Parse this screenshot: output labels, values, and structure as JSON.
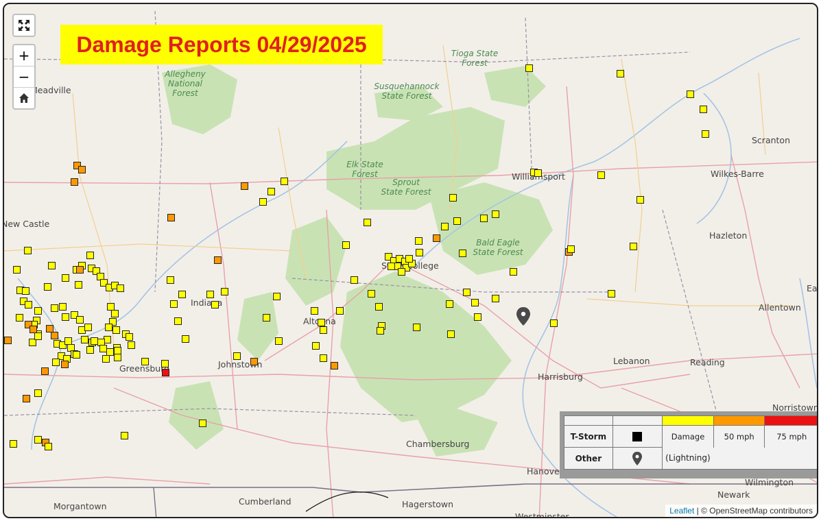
{
  "title": "Damage Reports 04/29/2025",
  "colors": {
    "damage": "#ffff00",
    "mph50": "#ff9900",
    "mph75": "#ee1111"
  },
  "controls": {
    "fullscreen_icon": "fullscreen-icon",
    "zoom_in": "+",
    "zoom_out": "−",
    "home_icon": "home-icon"
  },
  "places": [
    {
      "name": "Meadville"
    },
    {
      "name": "New Castle"
    },
    {
      "name": "Indiana"
    },
    {
      "name": "Altoona"
    },
    {
      "name": "State College"
    },
    {
      "name": "Johnstown"
    },
    {
      "name": "Greensburg"
    },
    {
      "name": "Williamsport"
    },
    {
      "name": "Scranton"
    },
    {
      "name": "Wilkes-Barre"
    },
    {
      "name": "Hazleton"
    },
    {
      "name": "Allentown"
    },
    {
      "name": "Lebanon"
    },
    {
      "name": "Reading"
    },
    {
      "name": "Harrisburg"
    },
    {
      "name": "Chambersburg"
    },
    {
      "name": "Hanover"
    },
    {
      "name": "Norristown"
    },
    {
      "name": "Morgantown"
    },
    {
      "name": "Cumberland"
    },
    {
      "name": "Hagerstown"
    },
    {
      "name": "Westminster"
    },
    {
      "name": "Wilmington"
    },
    {
      "name": "Newark"
    },
    {
      "name": "Easton"
    }
  ],
  "forests": [
    {
      "lines": [
        "Allegheny",
        "National",
        "Forest"
      ]
    },
    {
      "lines": [
        "Tioga State",
        "Forest"
      ]
    },
    {
      "lines": [
        "Susquehannock",
        "State Forest"
      ]
    },
    {
      "lines": [
        "Elk State",
        "Forest"
      ]
    },
    {
      "lines": [
        "Sprout",
        "State Forest"
      ]
    },
    {
      "lines": [
        "Bald Eagle",
        "State Forest"
      ]
    }
  ],
  "legend": {
    "tstorm_label": "T-Storm",
    "other_label": "Other",
    "damage_label": "Damage",
    "mph50_label": "50 mph",
    "mph75_label": "75 mph",
    "lightning_label": "(Lightning)",
    "tstorm_icon": "square-marker-icon",
    "other_icon": "pin-marker-icon"
  },
  "attribution": {
    "leaflet": "Leaflet",
    "osm": "| © OpenStreetMap contributors"
  }
}
